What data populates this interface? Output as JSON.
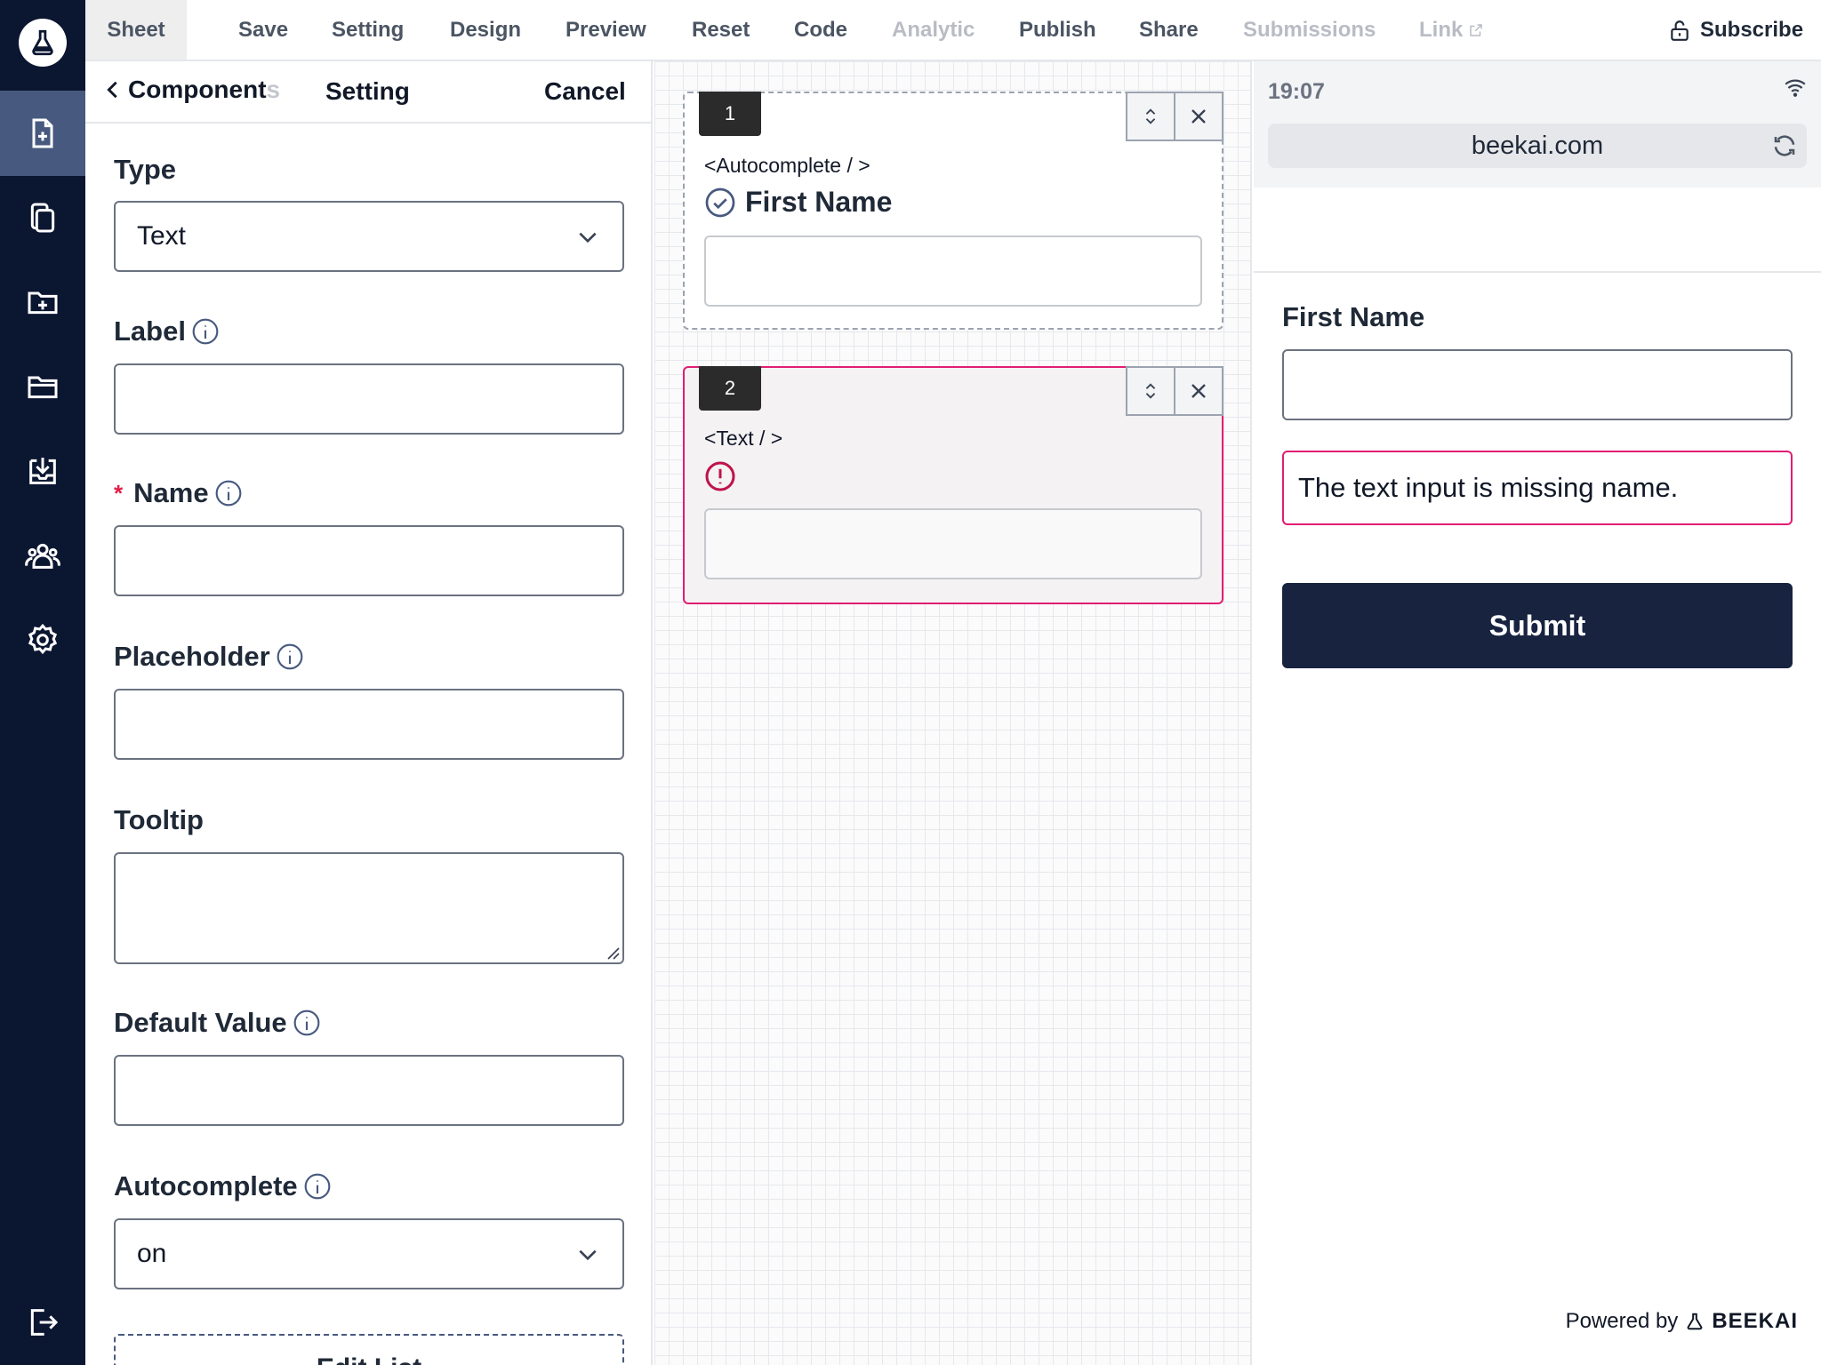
{
  "menu": {
    "items": [
      {
        "label": "Sheet",
        "state": "active"
      },
      {
        "label": "Save",
        "state": "normal"
      },
      {
        "label": "Setting",
        "state": "normal"
      },
      {
        "label": "Design",
        "state": "normal"
      },
      {
        "label": "Preview",
        "state": "normal"
      },
      {
        "label": "Reset",
        "state": "normal"
      },
      {
        "label": "Code",
        "state": "normal"
      },
      {
        "label": "Analytic",
        "state": "disabled"
      },
      {
        "label": "Publish",
        "state": "normal"
      },
      {
        "label": "Share",
        "state": "normal"
      },
      {
        "label": "Submissions",
        "state": "disabled"
      },
      {
        "label": "Link",
        "state": "disabled"
      }
    ],
    "subscribe_label": "Subscribe"
  },
  "rail": {
    "icons": [
      "logo-icon",
      "new-file-icon",
      "copy-icon",
      "new-folder-icon",
      "folder-icon",
      "download-icon",
      "users-icon",
      "gear-icon",
      "logout-icon"
    ],
    "active": "new-file-icon"
  },
  "settings": {
    "back_label": "Component",
    "back_label_fade": "s",
    "title": "Setting",
    "cancel_label": "Cancel",
    "type_label": "Type",
    "type_value": "Text",
    "label_label": "Label",
    "label_value": "",
    "name_required_mark": "*",
    "name_label": "Name",
    "name_value": "",
    "placeholder_label": "Placeholder",
    "placeholder_value": "",
    "tooltip_label": "Tooltip",
    "tooltip_value": "",
    "default_value_label": "Default Value",
    "default_value_value": "",
    "autocomplete_label": "Autocomplete",
    "autocomplete_value": "on",
    "edit_list_label": "Edit List"
  },
  "canvas": {
    "cards": [
      {
        "number": "1",
        "tag": "<Autocomplete / >",
        "title": "First Name",
        "status": "valid"
      },
      {
        "number": "2",
        "tag": "<Text / >",
        "title": "",
        "status": "error"
      }
    ]
  },
  "preview": {
    "time": "19:07",
    "url": "beekai.com",
    "field_label": "First Name",
    "field_value": "",
    "error_message": "The text input is missing name.",
    "submit_label": "Submit",
    "powered_by": "Powered by",
    "brand": "BEEKAI"
  },
  "colors": {
    "rail_bg": "#0b1631",
    "rail_active": "#47597e",
    "error": "#e11d74",
    "submit_bg": "#182340"
  }
}
